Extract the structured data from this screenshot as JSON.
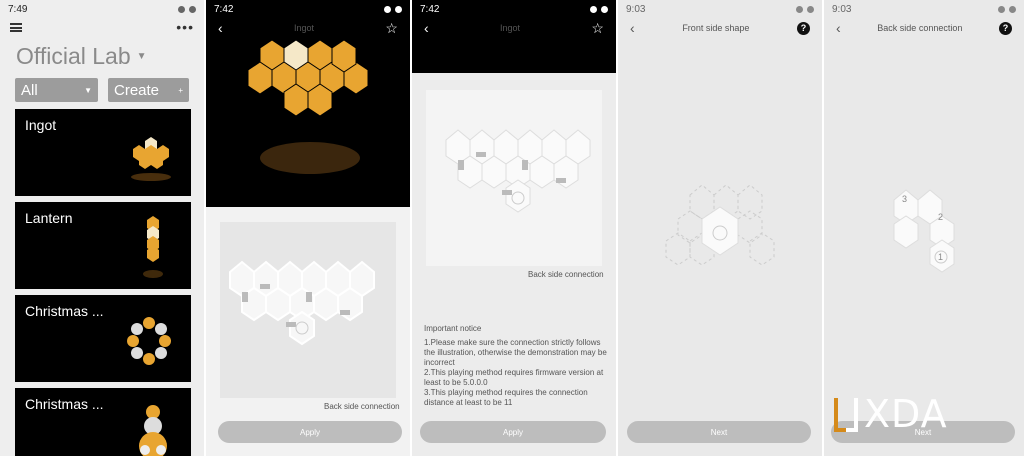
{
  "colors": {
    "accent": "#e8a531",
    "panel_bg": "#eeeeee",
    "dark": "#000000",
    "button": "#bdbdbd"
  },
  "p1": {
    "status_time": "7:49",
    "title": "Official Lab",
    "filter_all": "All",
    "filter_create": "Create",
    "cards": [
      {
        "label": "Ingot"
      },
      {
        "label": "Lantern"
      },
      {
        "label": "Christmas ..."
      },
      {
        "label": "Christmas ..."
      }
    ],
    "more": "• • •"
  },
  "p2": {
    "status_time": "7:42",
    "nav_title": "Ingot",
    "caption": "Back side connection",
    "apply": "Apply"
  },
  "p3": {
    "status_time": "7:42",
    "nav_title": "Ingot",
    "caption": "Back side connection",
    "notice_title": "Important notice",
    "notice_lines": [
      "1.Please make sure the connection strictly follows the illustration, otherwise the demonstration may be incorrect",
      "2.This playing method requires firmware version at least to be 5.0.0.0",
      "3.This playing method requires the connection distance at least to be 11"
    ],
    "apply": "Apply"
  },
  "p4": {
    "status_time": "9:03",
    "nav_title": "Front side shape",
    "next": "Next"
  },
  "p5": {
    "status_time": "9:03",
    "nav_title": "Back side connection",
    "numbers": [
      "3",
      "2",
      "1"
    ],
    "next": "Next"
  },
  "watermark": "XDA"
}
